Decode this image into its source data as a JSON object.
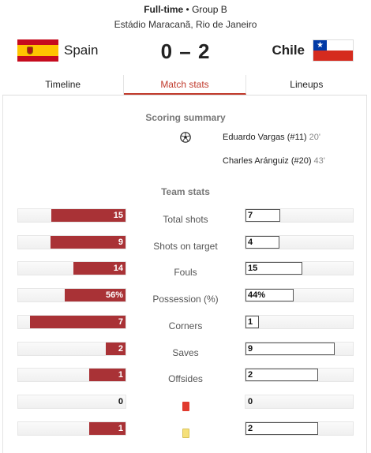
{
  "header": {
    "status": "Full-time",
    "separator": "•",
    "group": "Group B",
    "venue": "Estádio Maracanã, Rio de Janeiro"
  },
  "match": {
    "home_team": "Spain",
    "away_team": "Chile",
    "score": "0 – 2"
  },
  "tabs": [
    {
      "label": "Timeline"
    },
    {
      "label": "Match stats"
    },
    {
      "label": "Lineups"
    }
  ],
  "active_tab": "Match stats",
  "scoring": {
    "title": "Scoring summary",
    "icon": "soccer-ball-icon",
    "goals": [
      {
        "player": "Eduardo Vargas (#11)",
        "minute": "20'"
      },
      {
        "player": "Charles Aránguiz (#20)",
        "minute": "43'"
      }
    ]
  },
  "team_stats": {
    "title": "Team stats",
    "rows": [
      {
        "label": "Total shots",
        "home": "15",
        "away": "7",
        "home_fraction": 0.68,
        "away_fraction": 0.32
      },
      {
        "label": "Shots on target",
        "home": "9",
        "away": "4",
        "home_fraction": 0.69,
        "away_fraction": 0.31
      },
      {
        "label": "Fouls",
        "home": "14",
        "away": "15",
        "home_fraction": 0.48,
        "away_fraction": 0.52
      },
      {
        "label": "Possession (%)",
        "home": "56%",
        "away": "44%",
        "home_fraction": 0.56,
        "away_fraction": 0.44
      },
      {
        "label": "Corners",
        "home": "7",
        "away": "1",
        "home_fraction": 0.875,
        "away_fraction": 0.125
      },
      {
        "label": "Saves",
        "home": "2",
        "away": "9",
        "home_fraction": 0.18,
        "away_fraction": 0.82
      },
      {
        "label": "Offsides",
        "home": "1",
        "away": "2",
        "home_fraction": 0.33,
        "away_fraction": 0.67
      },
      {
        "label": "",
        "icon": "red-card-icon",
        "home": "0",
        "away": "0",
        "home_fraction": 0,
        "away_fraction": 0
      },
      {
        "label": "",
        "icon": "yellow-card-icon",
        "home": "1",
        "away": "2",
        "home_fraction": 0.33,
        "away_fraction": 0.67
      }
    ]
  },
  "colors": {
    "home_bar": "#a93236",
    "active_tab": "#c0392b",
    "red_card": "#e03a2e",
    "yellow_card": "#f5e07a"
  }
}
